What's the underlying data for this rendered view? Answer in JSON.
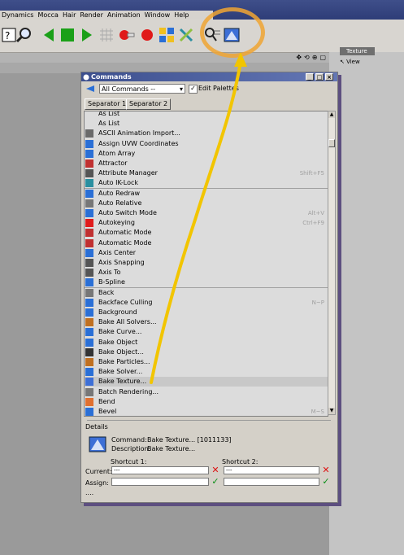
{
  "menu": {
    "items": [
      "Dynamics",
      "Mocca",
      "Hair",
      "Render",
      "Animation",
      "Window",
      "Help"
    ]
  },
  "toolbar": {
    "icons": [
      "help-question-icon",
      "search-magnifier-icon",
      "play-backward-icon",
      "stop-square-icon",
      "play-forward-icon",
      "grid-icon",
      "record-key-icon",
      "record-dot-icon",
      "palette-grid-icon",
      "tools-icon",
      "search-commands-icon",
      "bake-texture-icon"
    ]
  },
  "right_panel": {
    "tab": "Texture",
    "view": "View"
  },
  "dialog": {
    "title": "Commands",
    "dropdown_value": "All Commands --",
    "edit_palettes_label": "Edit Palettes",
    "edit_palettes_checked": "✓",
    "separators": [
      "Separator 1",
      "Separator 2"
    ],
    "commands": [
      {
        "name": "As List",
        "shortcut": ""
      },
      {
        "name": "As List",
        "shortcut": ""
      },
      {
        "name": "ASCII Animation Import...",
        "shortcut": ""
      },
      {
        "name": "Assign UVW Coordinates",
        "shortcut": ""
      },
      {
        "name": "Atom Array",
        "shortcut": ""
      },
      {
        "name": "Attractor",
        "shortcut": ""
      },
      {
        "name": "Attribute Manager",
        "shortcut": "Shift+F5"
      },
      {
        "name": "Auto IK-Lock",
        "shortcut": ""
      },
      {
        "name": "Auto Redraw",
        "shortcut": ""
      },
      {
        "name": "Auto Relative",
        "shortcut": ""
      },
      {
        "name": "Auto Switch Mode",
        "shortcut": "Alt+V"
      },
      {
        "name": "Autokeying",
        "shortcut": "Ctrl+F9"
      },
      {
        "name": "Automatic Mode",
        "shortcut": ""
      },
      {
        "name": "Automatic Mode",
        "shortcut": ""
      },
      {
        "name": "Axis Center",
        "shortcut": ""
      },
      {
        "name": "Axis Snapping",
        "shortcut": ""
      },
      {
        "name": "Axis To",
        "shortcut": ""
      },
      {
        "name": "B-Spline",
        "shortcut": ""
      },
      {
        "name": "Back",
        "shortcut": ""
      },
      {
        "name": "Backface Culling",
        "shortcut": "N~P"
      },
      {
        "name": "Background",
        "shortcut": ""
      },
      {
        "name": "Bake All Solvers...",
        "shortcut": ""
      },
      {
        "name": "Bake Curve...",
        "shortcut": ""
      },
      {
        "name": "Bake Object",
        "shortcut": ""
      },
      {
        "name": "Bake Object...",
        "shortcut": ""
      },
      {
        "name": "Bake Particles...",
        "shortcut": ""
      },
      {
        "name": "Bake Solver...",
        "shortcut": ""
      },
      {
        "name": "Bake Texture...",
        "shortcut": ""
      },
      {
        "name": "Batch Rendering...",
        "shortcut": ""
      },
      {
        "name": "Bend",
        "shortcut": ""
      },
      {
        "name": "Bevel",
        "shortcut": "M~S"
      }
    ],
    "details": {
      "heading": "Details",
      "command_label": "Command:",
      "command_value": "Bake Texture... [1011133]",
      "description_label": "Description:",
      "description_value": "Bake Texture...",
      "shortcut1_label": "Shortcut 1:",
      "shortcut2_label": "Shortcut 2:",
      "current_label": "Current:",
      "assign_label": "Assign:",
      "current1_value": "---",
      "current2_value": "---",
      "footer": "...."
    }
  }
}
